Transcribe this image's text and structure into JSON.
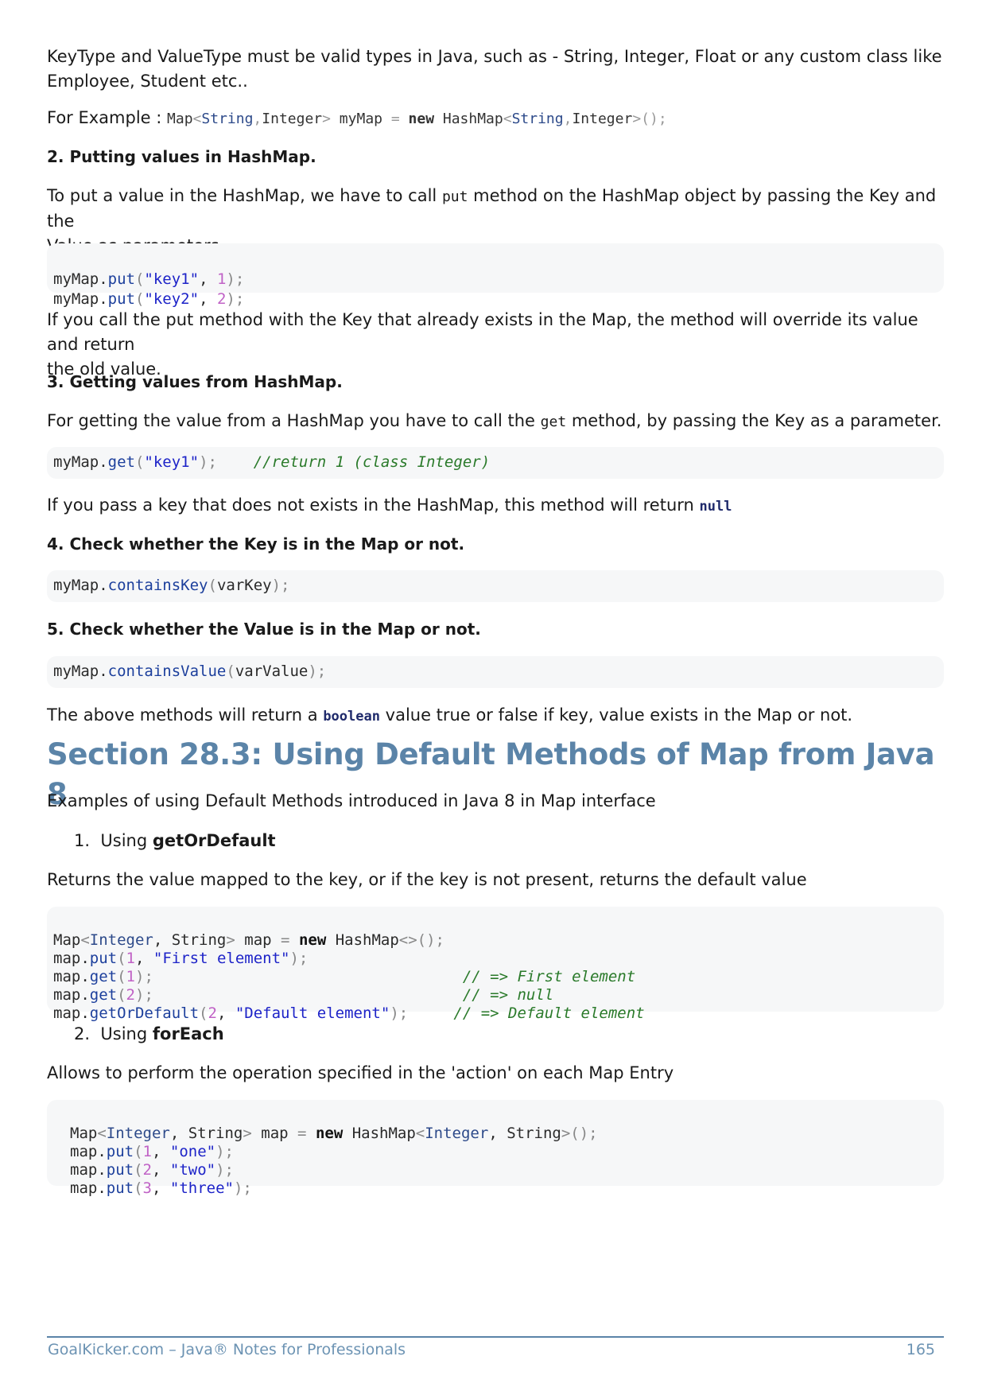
{
  "intro": {
    "line1": "KeyType and ValueType must be valid types in Java, such as - String, Integer, Float or any custom class like",
    "line2": "Employee, Student etc..",
    "example_label": "For Example : ",
    "example_code_parts": [
      "Map",
      "<",
      "String",
      ",",
      "Integer",
      ">",
      " myMap ",
      "=",
      " ",
      "new",
      " HashMap",
      "<",
      "String",
      ",",
      "Integer",
      ">",
      "();"
    ]
  },
  "s2": {
    "heading": "2. Putting values in HashMap.",
    "text_a": "To put a value in the HashMap, we have to call ",
    "text_code": "put",
    "text_b": " method on the HashMap object by passing the Key and the",
    "text_c": "Value as parameters.",
    "code_lines": [
      "myMap.put(\"key1\", 1);",
      "myMap.put(\"key2\", 2);"
    ],
    "note_1": "If you call the put method with the Key that already exists in the Map, the method will override its value and return",
    "note_2": "the old value."
  },
  "s3": {
    "heading": "3. Getting values from HashMap.",
    "text_a": "For getting the value from a HashMap you have to call the ",
    "text_code": "get",
    "text_b": " method, by passing the Key as a parameter.",
    "code": "myMap.get(\"key1\");",
    "code_comment": "//return 1 (class Integer)",
    "note_a": "If you pass a key that does not exists in the HashMap, this method will return ",
    "note_null": "null"
  },
  "s4": {
    "heading": "4. Check whether the Key is in the Map or not.",
    "code": "myMap.containsKey(varKey);"
  },
  "s5": {
    "heading": "5. Check whether the Value is in the Map or not.",
    "code": "myMap.containsValue(varValue);",
    "note_a": "The above methods will return a ",
    "note_bool": "boolean",
    "note_b": " value true or false if key, value exists in the Map or not."
  },
  "section": {
    "title": "Section 28.3: Using Default Methods of Map from Java 8",
    "intro": "Examples of using Default Methods introduced in Java 8 in Map interface",
    "item1_num": "1.",
    "item1_prefix": "Using ",
    "item1_bold": "getOrDefault",
    "item1_desc": "Returns the value mapped to the key, or if the key is not present, returns the default value",
    "code1": [
      "Map<Integer, String> map = new HashMap<>();",
      "map.put(1, \"First element\");",
      "map.get(1);",
      "map.get(2);",
      "map.getOrDefault(2, \"Default element\");"
    ],
    "code1_comments": [
      "",
      "",
      "// => First element",
      "// => null",
      "// => Default element"
    ],
    "item2_num": "2.",
    "item2_prefix": "Using ",
    "item2_bold": "forEach",
    "item2_desc": "Allows to perform the operation specified in the 'action' on each Map Entry",
    "code2": [
      "Map<Integer, String> map = new HashMap<Integer, String>();",
      "map.put(1, \"one\");",
      "map.put(2, \"two\");",
      "map.put(3, \"three\");"
    ]
  },
  "footer": {
    "left": "GoalKicker.com – Java® Notes for Professionals",
    "right": "165"
  }
}
